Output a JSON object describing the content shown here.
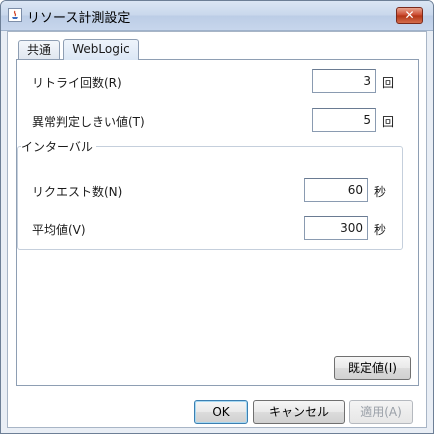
{
  "window": {
    "title": "リソース計測設定",
    "close_symbol": "✕"
  },
  "tabs": [
    {
      "label": "共通",
      "active": false
    },
    {
      "label": "WebLogic",
      "active": true
    }
  ],
  "fields": {
    "retry_count": {
      "label": "リトライ回数(R)",
      "value": "3",
      "unit": "回"
    },
    "threshold": {
      "label": "異常判定しきい値(T)",
      "value": "5",
      "unit": "回"
    }
  },
  "interval_group": {
    "title": "インターバル",
    "request_count": {
      "label": "リクエスト数(N)",
      "value": "60",
      "unit": "秒"
    },
    "average": {
      "label": "平均値(V)",
      "value": "300",
      "unit": "秒"
    }
  },
  "buttons": {
    "defaults": "既定値(I)",
    "ok": "OK",
    "cancel": "キャンセル",
    "apply": "適用(A)"
  }
}
